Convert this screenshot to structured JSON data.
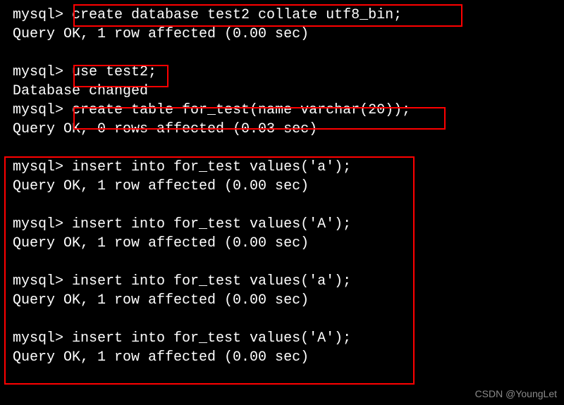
{
  "terminal": {
    "prompt": "mysql> ",
    "lines": [
      {
        "type": "cmd",
        "text": "create database test2 collate utf8_bin;"
      },
      {
        "type": "out",
        "text": "Query OK, 1 row affected (0.00 sec)"
      },
      {
        "type": "blank"
      },
      {
        "type": "cmd",
        "text": "use test2;"
      },
      {
        "type": "out",
        "text": "Database changed"
      },
      {
        "type": "cmd",
        "text": "create table for_test(name varchar(20));"
      },
      {
        "type": "out",
        "text": "Query OK, 0 rows affected (0.03 sec)"
      },
      {
        "type": "blank"
      },
      {
        "type": "cmd",
        "text": "insert into for_test values('a');"
      },
      {
        "type": "out",
        "text": "Query OK, 1 row affected (0.00 sec)"
      },
      {
        "type": "blank"
      },
      {
        "type": "cmd",
        "text": "insert into for_test values('A');"
      },
      {
        "type": "out",
        "text": "Query OK, 1 row affected (0.00 sec)"
      },
      {
        "type": "blank"
      },
      {
        "type": "cmd",
        "text": "insert into for_test values('a');"
      },
      {
        "type": "out",
        "text": "Query OK, 1 row affected (0.00 sec)"
      },
      {
        "type": "blank"
      },
      {
        "type": "cmd",
        "text": "insert into for_test values('A');"
      },
      {
        "type": "out",
        "text": "Query OK, 1 row affected (0.00 sec)"
      }
    ]
  },
  "watermark": "CSDN @YoungLet"
}
